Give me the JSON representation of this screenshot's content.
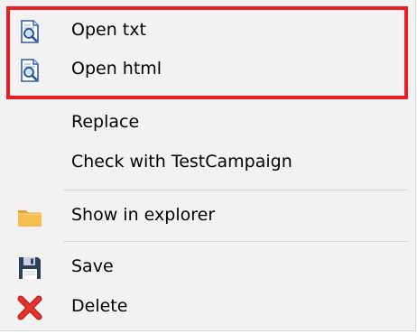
{
  "menu": {
    "items": [
      {
        "label": "Open txt",
        "icon": "search-document-icon"
      },
      {
        "label": "Open html",
        "icon": "search-document-icon"
      },
      {
        "label": "Replace",
        "icon": ""
      },
      {
        "label": "Check with TestCampaign",
        "icon": ""
      },
      {
        "label": "Show in explorer",
        "icon": "folder-icon"
      },
      {
        "label": "Save",
        "icon": "floppy-disk-icon"
      },
      {
        "label": "Delete",
        "icon": "red-x-icon"
      }
    ]
  },
  "colors": {
    "highlight_border": "#ee1c25",
    "menu_background": "#f2f2f2",
    "separator": "#d4d4d4",
    "folder": "#f4b840",
    "delete_x": "#e5322d",
    "floppy": "#2d3f5c"
  }
}
